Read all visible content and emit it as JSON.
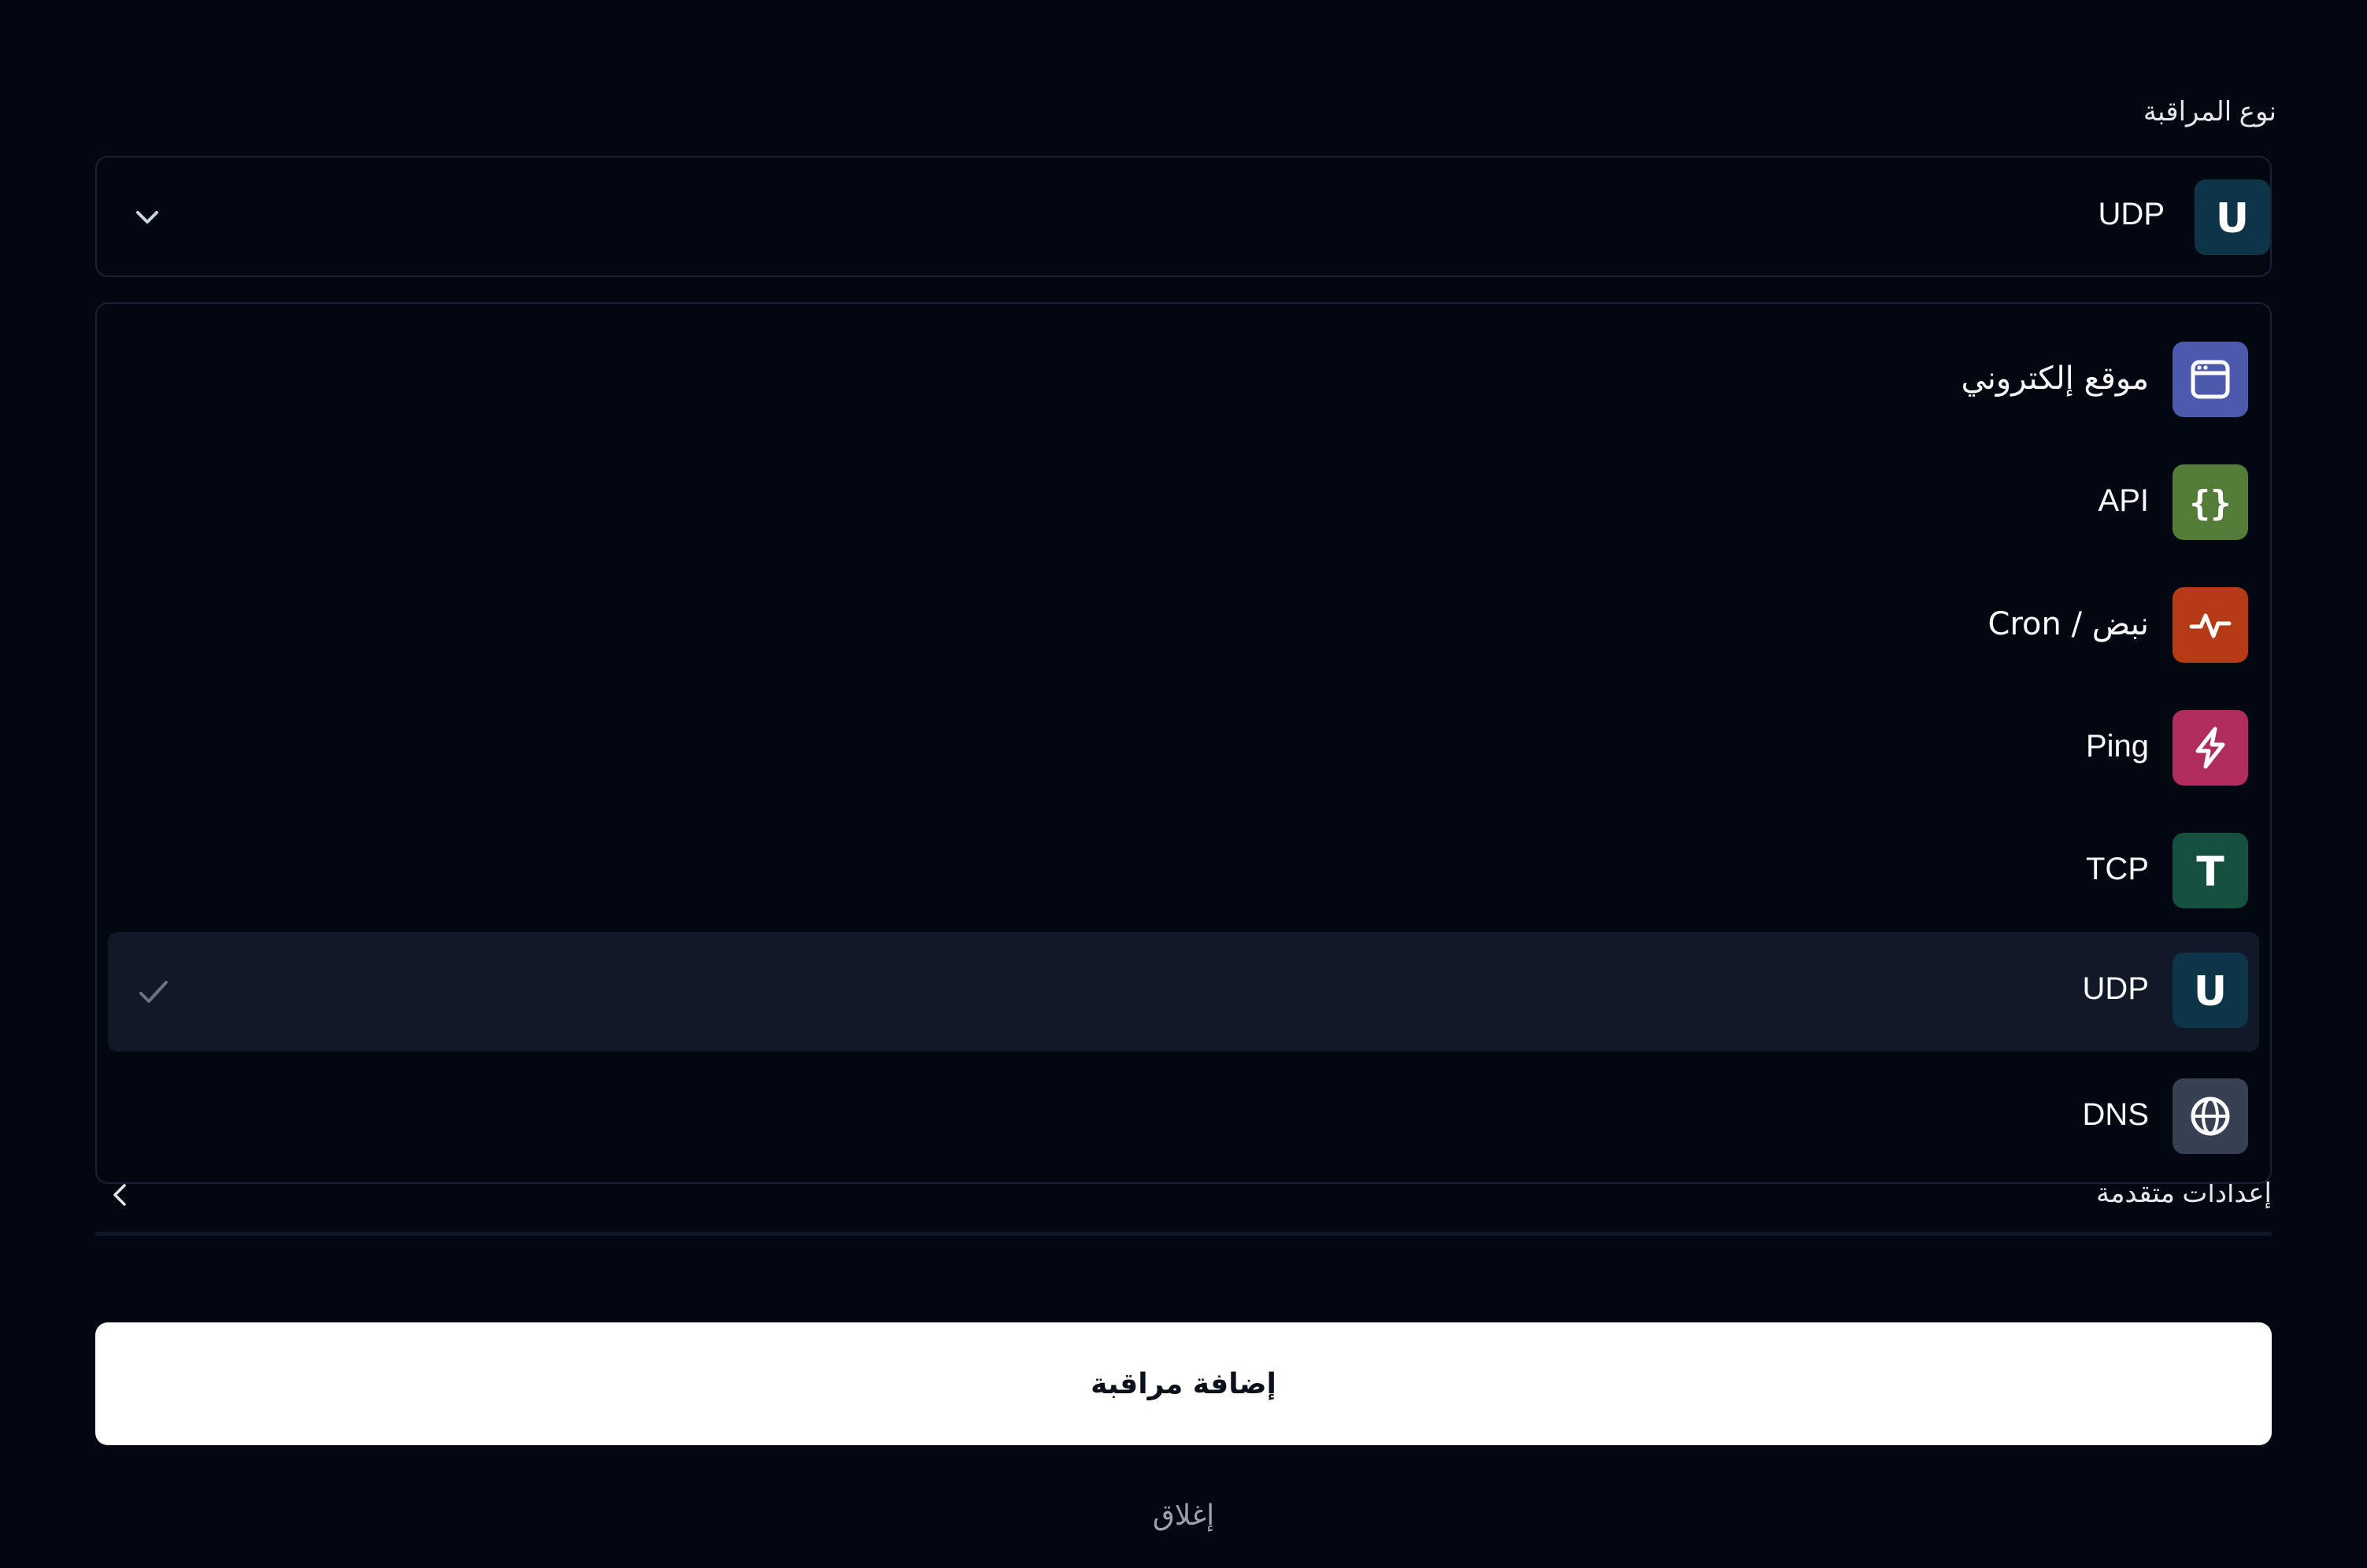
{
  "form": {
    "monitor_type_label": "نوع المراقبة",
    "select": {
      "value": "UDP",
      "icon": "udp-icon",
      "icon_color": "#0e3547"
    },
    "options": [
      {
        "label": "موقع إلكتروني",
        "icon": "browser-window-icon",
        "icon_color": "#4c59ac",
        "selected": false
      },
      {
        "label": "API",
        "icon": "curly-braces-icon",
        "icon_color": "#537c38",
        "selected": false
      },
      {
        "label": "Cron / نبض",
        "icon": "heartbeat-icon",
        "icon_color": "#b53b17",
        "selected": false
      },
      {
        "label": "Ping",
        "icon": "lightning-icon",
        "icon_color": "#b02c5d",
        "selected": false
      },
      {
        "label": "TCP",
        "icon": "tcp-icon",
        "icon_color": "#154f3e",
        "selected": false
      },
      {
        "label": "UDP",
        "icon": "udp-icon",
        "icon_color": "#0e3547",
        "selected": true
      },
      {
        "label": "DNS",
        "icon": "globe-icon",
        "icon_color": "#374151",
        "selected": false
      }
    ],
    "advanced_settings_label": "إعدادات متقدمة",
    "submit_label": "إضافة مراقبة",
    "close_label": "إغلاق"
  },
  "colors": {
    "background": "#030712",
    "border": "#1a2130",
    "selected_row": "#111827",
    "primary_button": "#ffffff",
    "muted_text": "#9ca3af"
  }
}
